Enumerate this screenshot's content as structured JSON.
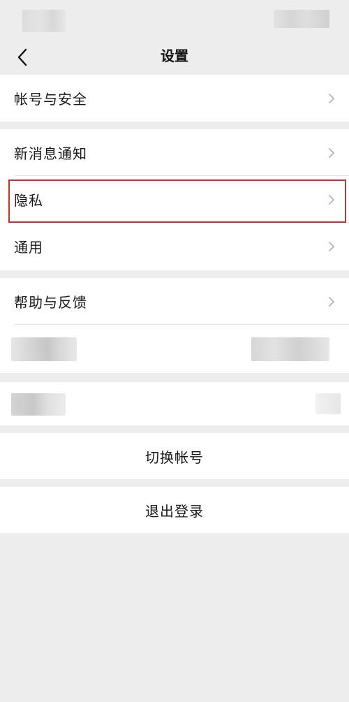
{
  "header": {
    "title": "设置",
    "back_icon": "chevron-left-icon"
  },
  "groups": {
    "account": {
      "items": [
        {
          "label": "帐号与安全",
          "icon": "chevron-right-icon"
        }
      ]
    },
    "general": {
      "items": [
        {
          "label": "新消息通知",
          "icon": "chevron-right-icon"
        },
        {
          "label": "隐私",
          "icon": "chevron-right-icon",
          "highlighted": true
        },
        {
          "label": "通用",
          "icon": "chevron-right-icon"
        }
      ]
    },
    "help": {
      "items": [
        {
          "label": "帮助与反馈",
          "icon": "chevron-right-icon"
        }
      ]
    }
  },
  "actions": {
    "switch_account": "切换帐号",
    "logout": "退出登录"
  },
  "colors": {
    "background": "#ededed",
    "card": "#ffffff",
    "text": "#191919",
    "chevron": "#b2b2b2",
    "highlight": "#d62a2a"
  }
}
